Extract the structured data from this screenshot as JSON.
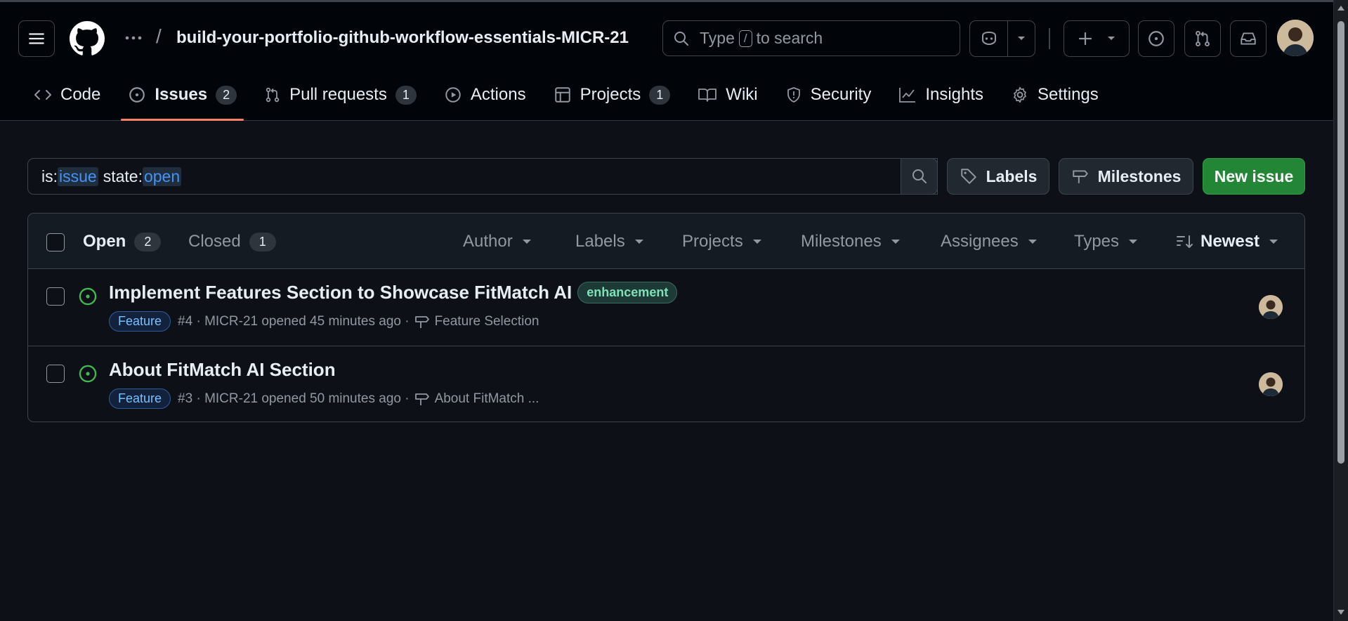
{
  "header": {
    "repo_title": "build-your-portfolio-github-workflow-essentials-MICR-21",
    "separator": "/",
    "search": {
      "prefix": "Type",
      "key": "/",
      "suffix": "to search"
    }
  },
  "nav": {
    "tabs": [
      {
        "label": "Code",
        "icon": "code-icon"
      },
      {
        "label": "Issues",
        "icon": "issue-opened-icon",
        "count": "2",
        "active": true
      },
      {
        "label": "Pull requests",
        "icon": "git-pull-request-icon",
        "count": "1"
      },
      {
        "label": "Actions",
        "icon": "play-icon"
      },
      {
        "label": "Projects",
        "icon": "table-icon",
        "count": "1"
      },
      {
        "label": "Wiki",
        "icon": "book-icon"
      },
      {
        "label": "Security",
        "icon": "shield-icon"
      },
      {
        "label": "Insights",
        "icon": "graph-icon"
      },
      {
        "label": "Settings",
        "icon": "gear-icon"
      }
    ]
  },
  "filter": {
    "is_prefix": "is:",
    "is_value": "issue",
    "state_prefix": "state:",
    "state_value": "open",
    "labels_button": "Labels",
    "milestones_button": "Milestones",
    "new_issue_button": "New issue"
  },
  "list": {
    "open_label": "Open",
    "open_count": "2",
    "closed_label": "Closed",
    "closed_count": "1",
    "filters": [
      "Author",
      "Labels",
      "Projects",
      "Milestones",
      "Assignees",
      "Types"
    ],
    "sort_label": "Newest",
    "issues": [
      {
        "title": "Implement Features Section to Showcase FitMatch AI",
        "label": "enhancement",
        "type": "Feature",
        "meta": "#4 · MICR-21 opened 45 minutes ago ·",
        "milestone": "Feature Selection"
      },
      {
        "title": "About FitMatch AI Section",
        "type": "Feature",
        "meta": "#3 · MICR-21 opened 50 minutes ago ·",
        "milestone": "About FitMatch ..."
      }
    ]
  },
  "colors": {
    "background": "#0d1117",
    "header": "#010409",
    "border": "#3d444d",
    "accent_underline": "#f78166",
    "open_green": "#3fb950",
    "primary_button": "#238636",
    "link_blue": "#4493f8"
  }
}
